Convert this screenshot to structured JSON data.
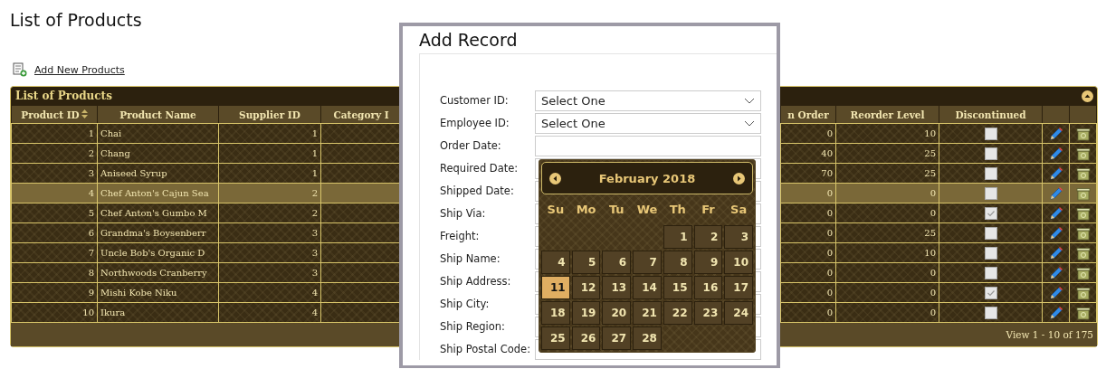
{
  "page_title": "List of Products",
  "add_link": "Add New Products",
  "grid": {
    "caption": "List of Products",
    "columns": [
      {
        "label": "Product ID",
        "sorted": true
      },
      {
        "label": "Product Name",
        "sorted": false
      },
      {
        "label": "Supplier ID",
        "sorted": false
      },
      {
        "label": "Category I",
        "sorted": false
      },
      {
        "label": "n Order",
        "sorted": false
      },
      {
        "label": "Reorder Level",
        "sorted": false
      },
      {
        "label": "Discontinued",
        "sorted": false
      }
    ],
    "rows": [
      {
        "id": "1",
        "name": "Chai",
        "supplier": "1",
        "on_order": "0",
        "reorder": "10",
        "discontinued": false,
        "highlighted": false
      },
      {
        "id": "2",
        "name": "Chang",
        "supplier": "1",
        "on_order": "40",
        "reorder": "25",
        "discontinued": false,
        "highlighted": false
      },
      {
        "id": "3",
        "name": "Aniseed Syrup",
        "supplier": "1",
        "on_order": "70",
        "reorder": "25",
        "discontinued": false,
        "highlighted": false
      },
      {
        "id": "4",
        "name": "Chef Anton's Cajun Sea",
        "supplier": "2",
        "on_order": "0",
        "reorder": "0",
        "discontinued": false,
        "highlighted": true
      },
      {
        "id": "5",
        "name": "Chef Anton's Gumbo M",
        "supplier": "2",
        "on_order": "0",
        "reorder": "0",
        "discontinued": true,
        "highlighted": false
      },
      {
        "id": "6",
        "name": "Grandma's Boysenberr",
        "supplier": "3",
        "on_order": "0",
        "reorder": "25",
        "discontinued": false,
        "highlighted": false
      },
      {
        "id": "7",
        "name": "Uncle Bob's Organic D",
        "supplier": "3",
        "on_order": "0",
        "reorder": "10",
        "discontinued": false,
        "highlighted": false
      },
      {
        "id": "8",
        "name": "Northwoods Cranberry",
        "supplier": "3",
        "on_order": "0",
        "reorder": "0",
        "discontinued": false,
        "highlighted": false
      },
      {
        "id": "9",
        "name": "Mishi Kobe Niku",
        "supplier": "4",
        "on_order": "0",
        "reorder": "0",
        "discontinued": true,
        "highlighted": false
      },
      {
        "id": "10",
        "name": "Ikura",
        "supplier": "4",
        "on_order": "0",
        "reorder": "0",
        "discontinued": false,
        "highlighted": false
      }
    ],
    "pager": "View 1 - 10 of 175"
  },
  "dialog": {
    "title": "Add Record",
    "fields": [
      {
        "label": "Customer ID:",
        "kind": "select",
        "value": "Select One"
      },
      {
        "label": "Employee ID:",
        "kind": "select",
        "value": "Select One"
      },
      {
        "label": "Order Date:",
        "kind": "text"
      },
      {
        "label": "Required Date:",
        "kind": "text"
      },
      {
        "label": "Shipped Date:",
        "kind": "text"
      },
      {
        "label": "Ship Via:",
        "kind": "text"
      },
      {
        "label": "Freight:",
        "kind": "text"
      },
      {
        "label": "Ship Name:",
        "kind": "text"
      },
      {
        "label": "Ship Address:",
        "kind": "text"
      },
      {
        "label": "Ship City:",
        "kind": "text"
      },
      {
        "label": "Ship Region:",
        "kind": "text"
      },
      {
        "label": "Ship Postal Code:",
        "kind": "text"
      }
    ]
  },
  "calendar": {
    "month": "February 2018",
    "weekdays": [
      "Su",
      "Mo",
      "Tu",
      "We",
      "Th",
      "Fr",
      "Sa"
    ],
    "weeks": [
      [
        {
          "kind": "blank"
        },
        {
          "kind": "blank"
        },
        {
          "kind": "blank"
        },
        {
          "kind": "blank"
        },
        {
          "kind": "day",
          "label": "1",
          "selected": false
        },
        {
          "kind": "day",
          "label": "2",
          "selected": false
        },
        {
          "kind": "day",
          "label": "3",
          "selected": false
        }
      ],
      [
        {
          "kind": "day",
          "label": "4",
          "selected": false
        },
        {
          "kind": "day",
          "label": "5",
          "selected": false
        },
        {
          "kind": "day",
          "label": "6",
          "selected": false
        },
        {
          "kind": "day",
          "label": "7",
          "selected": false
        },
        {
          "kind": "day",
          "label": "8",
          "selected": false
        },
        {
          "kind": "day",
          "label": "9",
          "selected": false
        },
        {
          "kind": "day",
          "label": "10",
          "selected": false
        }
      ],
      [
        {
          "kind": "day",
          "label": "11",
          "selected": true
        },
        {
          "kind": "day",
          "label": "12",
          "selected": false
        },
        {
          "kind": "day",
          "label": "13",
          "selected": false
        },
        {
          "kind": "day",
          "label": "14",
          "selected": false
        },
        {
          "kind": "day",
          "label": "15",
          "selected": false
        },
        {
          "kind": "day",
          "label": "16",
          "selected": false
        },
        {
          "kind": "day",
          "label": "17",
          "selected": false
        }
      ],
      [
        {
          "kind": "day",
          "label": "18",
          "selected": false
        },
        {
          "kind": "day",
          "label": "19",
          "selected": false
        },
        {
          "kind": "day",
          "label": "20",
          "selected": false
        },
        {
          "kind": "day",
          "label": "21",
          "selected": false
        },
        {
          "kind": "day",
          "label": "22",
          "selected": false
        },
        {
          "kind": "day",
          "label": "23",
          "selected": false
        },
        {
          "kind": "day",
          "label": "24",
          "selected": false
        }
      ],
      [
        {
          "kind": "day",
          "label": "25",
          "selected": false
        },
        {
          "kind": "day",
          "label": "26",
          "selected": false
        },
        {
          "kind": "day",
          "label": "27",
          "selected": false
        },
        {
          "kind": "day",
          "label": "28",
          "selected": false
        }
      ]
    ]
  }
}
